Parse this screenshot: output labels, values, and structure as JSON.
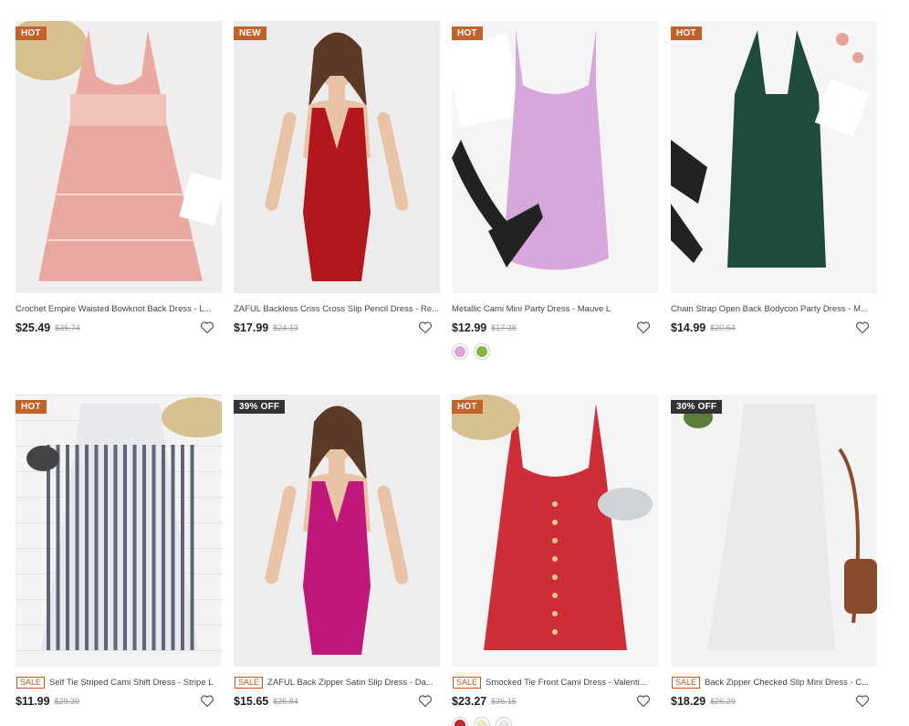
{
  "products": [
    {
      "badge": "HOT",
      "badge_type": "hot",
      "sale": "",
      "title": "Crochet Empire Waisted Bowknot Back Dress - L...",
      "price": "$25.49",
      "old_price": "$36.74",
      "swatches": [],
      "image": "pink-tiered-dress",
      "bg": "#efeeed",
      "dress": "#e9a9a1"
    },
    {
      "badge": "NEW",
      "badge_type": "new",
      "sale": "",
      "title": "ZAFUL Backless Criss Cross Slip Pencil Dress - Re...",
      "price": "$17.99",
      "old_price": "$24.13",
      "swatches": [],
      "image": "red-satin-model",
      "bg": "#ececec",
      "dress": "#b3171e"
    },
    {
      "badge": "HOT",
      "badge_type": "hot",
      "sale": "",
      "title": "Metallic Cami Mini Party Dress - Mauve L",
      "price": "$12.99",
      "old_price": "$17.38",
      "swatches": [
        "#d9a6d8",
        "#8bb33f"
      ],
      "image": "mauve-metallic-dress",
      "bg": "#f4f4f4",
      "dress": "#d7a6da"
    },
    {
      "badge": "HOT",
      "badge_type": "hot",
      "sale": "",
      "title": "Chain Strap Open Back Bodycon Party Dress - M...",
      "price": "$14.99",
      "old_price": "$20.64",
      "swatches": [],
      "image": "green-bodycon-dress",
      "bg": "#f5f5f5",
      "dress": "#1f4b3a"
    },
    {
      "badge": "HOT",
      "badge_type": "hot",
      "sale": "SALE",
      "title": "Self Tie Striped Cami Shift Dress - Stripe L",
      "price": "$11.99",
      "old_price": "$29.39",
      "swatches": [],
      "image": "striped-shift-dress",
      "bg": "#f3f3f3",
      "dress": "#5d6577"
    },
    {
      "badge": "39% OFF",
      "badge_type": "off",
      "sale": "SALE",
      "title": "ZAFUL Back Zipper Satin Slip Dress - Da...",
      "price": "$15.65",
      "old_price": "$25.84",
      "swatches": [],
      "image": "magenta-satin-model",
      "bg": "#ededed",
      "dress": "#c0177a"
    },
    {
      "badge": "HOT",
      "badge_type": "hot",
      "sale": "SALE",
      "title": "Smocked Tie Front Cami Dress - Valenti...",
      "price": "$23.27",
      "old_price": "$36.15",
      "swatches": [
        "#c02a3a",
        "#efe6c4",
        "#e8e8e8"
      ],
      "image": "red-button-dress",
      "bg": "#f4f4f4",
      "dress": "#cd2e37"
    },
    {
      "badge": "30% OFF",
      "badge_type": "off",
      "sale": "SALE",
      "title": "Back Zipper Checked Slip Mini Dress - C...",
      "price": "$18.29",
      "old_price": "$26.29",
      "swatches": [],
      "image": "gingham-mini-dress",
      "bg": "#f3f3f3",
      "dress": "#777777"
    }
  ]
}
